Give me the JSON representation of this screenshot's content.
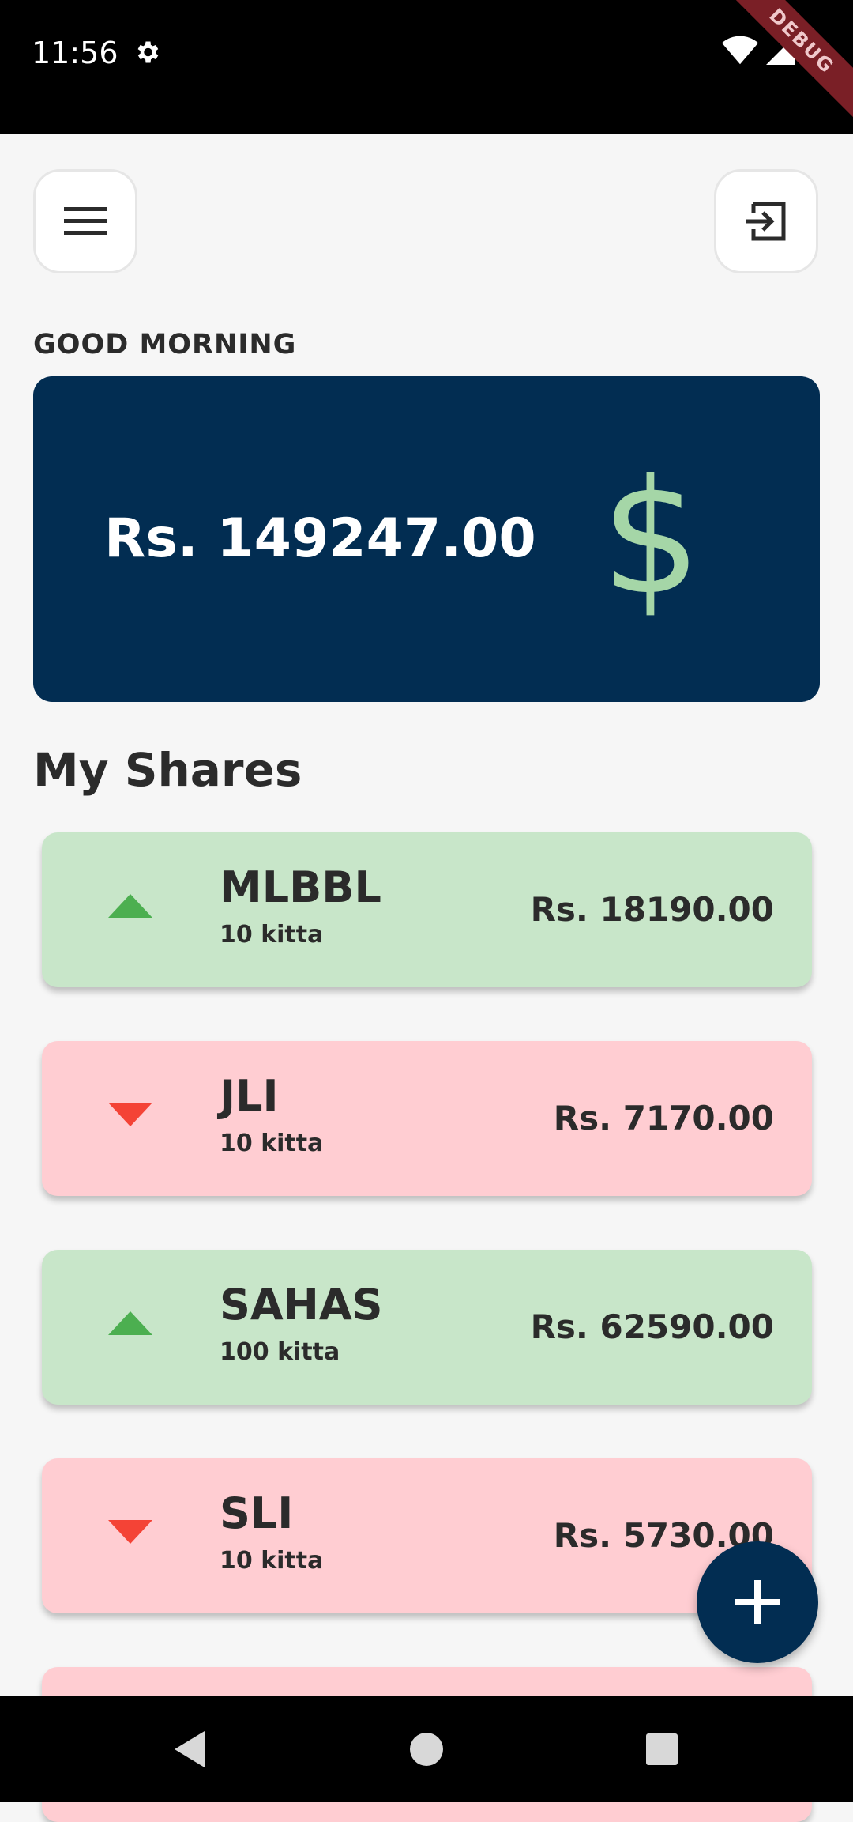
{
  "status_bar": {
    "time": "11:56",
    "debug_label": "DEBUG"
  },
  "header": {
    "menu_icon": "menu-icon",
    "logout_icon": "logout-icon"
  },
  "greeting": "GOOD MORNING",
  "balance": {
    "amount": "Rs. 149247.00",
    "symbol": "$"
  },
  "shares": {
    "title": "My Shares",
    "items": [
      {
        "symbol": "MLBBL",
        "kitta": "10 kitta",
        "value": "Rs. 18190.00",
        "trend": "up"
      },
      {
        "symbol": "JLI",
        "kitta": "10 kitta",
        "value": "Rs. 7170.00",
        "trend": "down"
      },
      {
        "symbol": "SAHAS",
        "kitta": "100 kitta",
        "value": "Rs. 62590.00",
        "trend": "up"
      },
      {
        "symbol": "SLI",
        "kitta": "10 kitta",
        "value": "Rs. 5730.00",
        "trend": "down"
      }
    ]
  },
  "colors": {
    "primary": "#022d52",
    "up_card": "#c8e6c9",
    "down_card": "#ffcdd2",
    "up_arrow": "#4caf50",
    "down_arrow": "#f44336",
    "dollar": "#a5d6a7"
  }
}
